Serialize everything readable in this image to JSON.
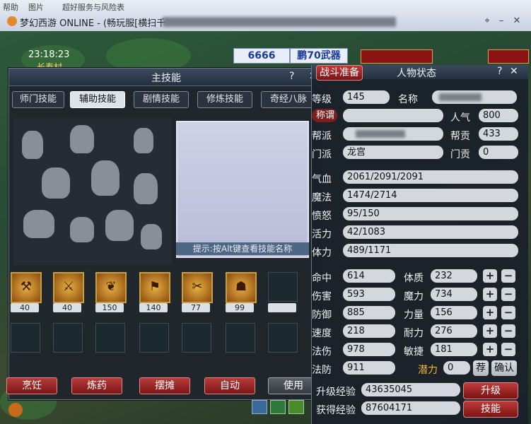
{
  "window": {
    "menu": [
      "帮助",
      "图片",
      "超好服务与风险表"
    ],
    "title": "梦幻西游 ONLINE - (畅玩服[横扫千"
  },
  "hud": {
    "time": "23:18:23",
    "location": "长寿村",
    "score": "6666",
    "banner": "鹏70武器"
  },
  "skill_panel": {
    "title": "主技能",
    "help": "?",
    "close": "✕",
    "tabs": [
      "师门技能",
      "辅助技能",
      "剧情技能",
      "修炼技能",
      "奇经八脉"
    ],
    "active_tab": 1,
    "hint": "提示:按Alt键查看技能名称",
    "skills": [
      {
        "level": "40",
        "icon": "cooking-icon"
      },
      {
        "level": "40",
        "icon": "smithing-icon"
      },
      {
        "level": "150",
        "icon": "herb-icon"
      },
      {
        "level": "140",
        "icon": "strengthen-icon"
      },
      {
        "level": "77",
        "icon": "crafting-icon"
      },
      {
        "level": "99",
        "icon": "building-icon"
      }
    ],
    "buttons": [
      "烹饪",
      "炼药",
      "摆摊",
      "自动",
      "使用"
    ]
  },
  "status_panel": {
    "battle_prep": "战斗准备",
    "title": "人物状态",
    "help": "?",
    "close": "✕",
    "level_label": "等级",
    "level": "145",
    "name_label": "名称",
    "title_label": "称谓",
    "popularity_label": "人气",
    "popularity": "800",
    "gang_label": "帮派",
    "gang_contrib_label": "帮贡",
    "gang_contrib": "433",
    "sect_label": "门派",
    "sect": "龙宫",
    "sect_contrib_label": "门贡",
    "sect_contrib": "0",
    "hp_label": "气血",
    "hp": "2061/2091/2091",
    "mp_label": "魔法",
    "mp": "1474/2714",
    "anger_label": "愤怒",
    "anger": "95/150",
    "vitality_label": "活力",
    "vitality": "42/1083",
    "stamina_label": "体力",
    "stamina": "489/1171",
    "stats": [
      {
        "label": "命中",
        "value": "614",
        "attr_label": "体质",
        "attr": "232"
      },
      {
        "label": "伤害",
        "value": "593",
        "attr_label": "魔力",
        "attr": "734"
      },
      {
        "label": "防御",
        "value": "885",
        "attr_label": "力量",
        "attr": "156"
      },
      {
        "label": "速度",
        "value": "218",
        "attr_label": "耐力",
        "attr": "276"
      },
      {
        "label": "法伤",
        "value": "978",
        "attr_label": "敏捷",
        "attr": "181"
      }
    ],
    "mdef_label": "法防",
    "mdef": "911",
    "potential_label": "潜力",
    "potential": "0",
    "recommend": "荐",
    "confirm": "确认",
    "upgrade_exp_label": "升级经验",
    "upgrade_exp": "43635045",
    "upgrade_button": "升级",
    "gained_exp_label": "获得经验",
    "gained_exp": "87604171",
    "skill_button": "技能"
  },
  "colors": {
    "accent_red": "#8a1212",
    "potential_gold": "#f2b632"
  }
}
